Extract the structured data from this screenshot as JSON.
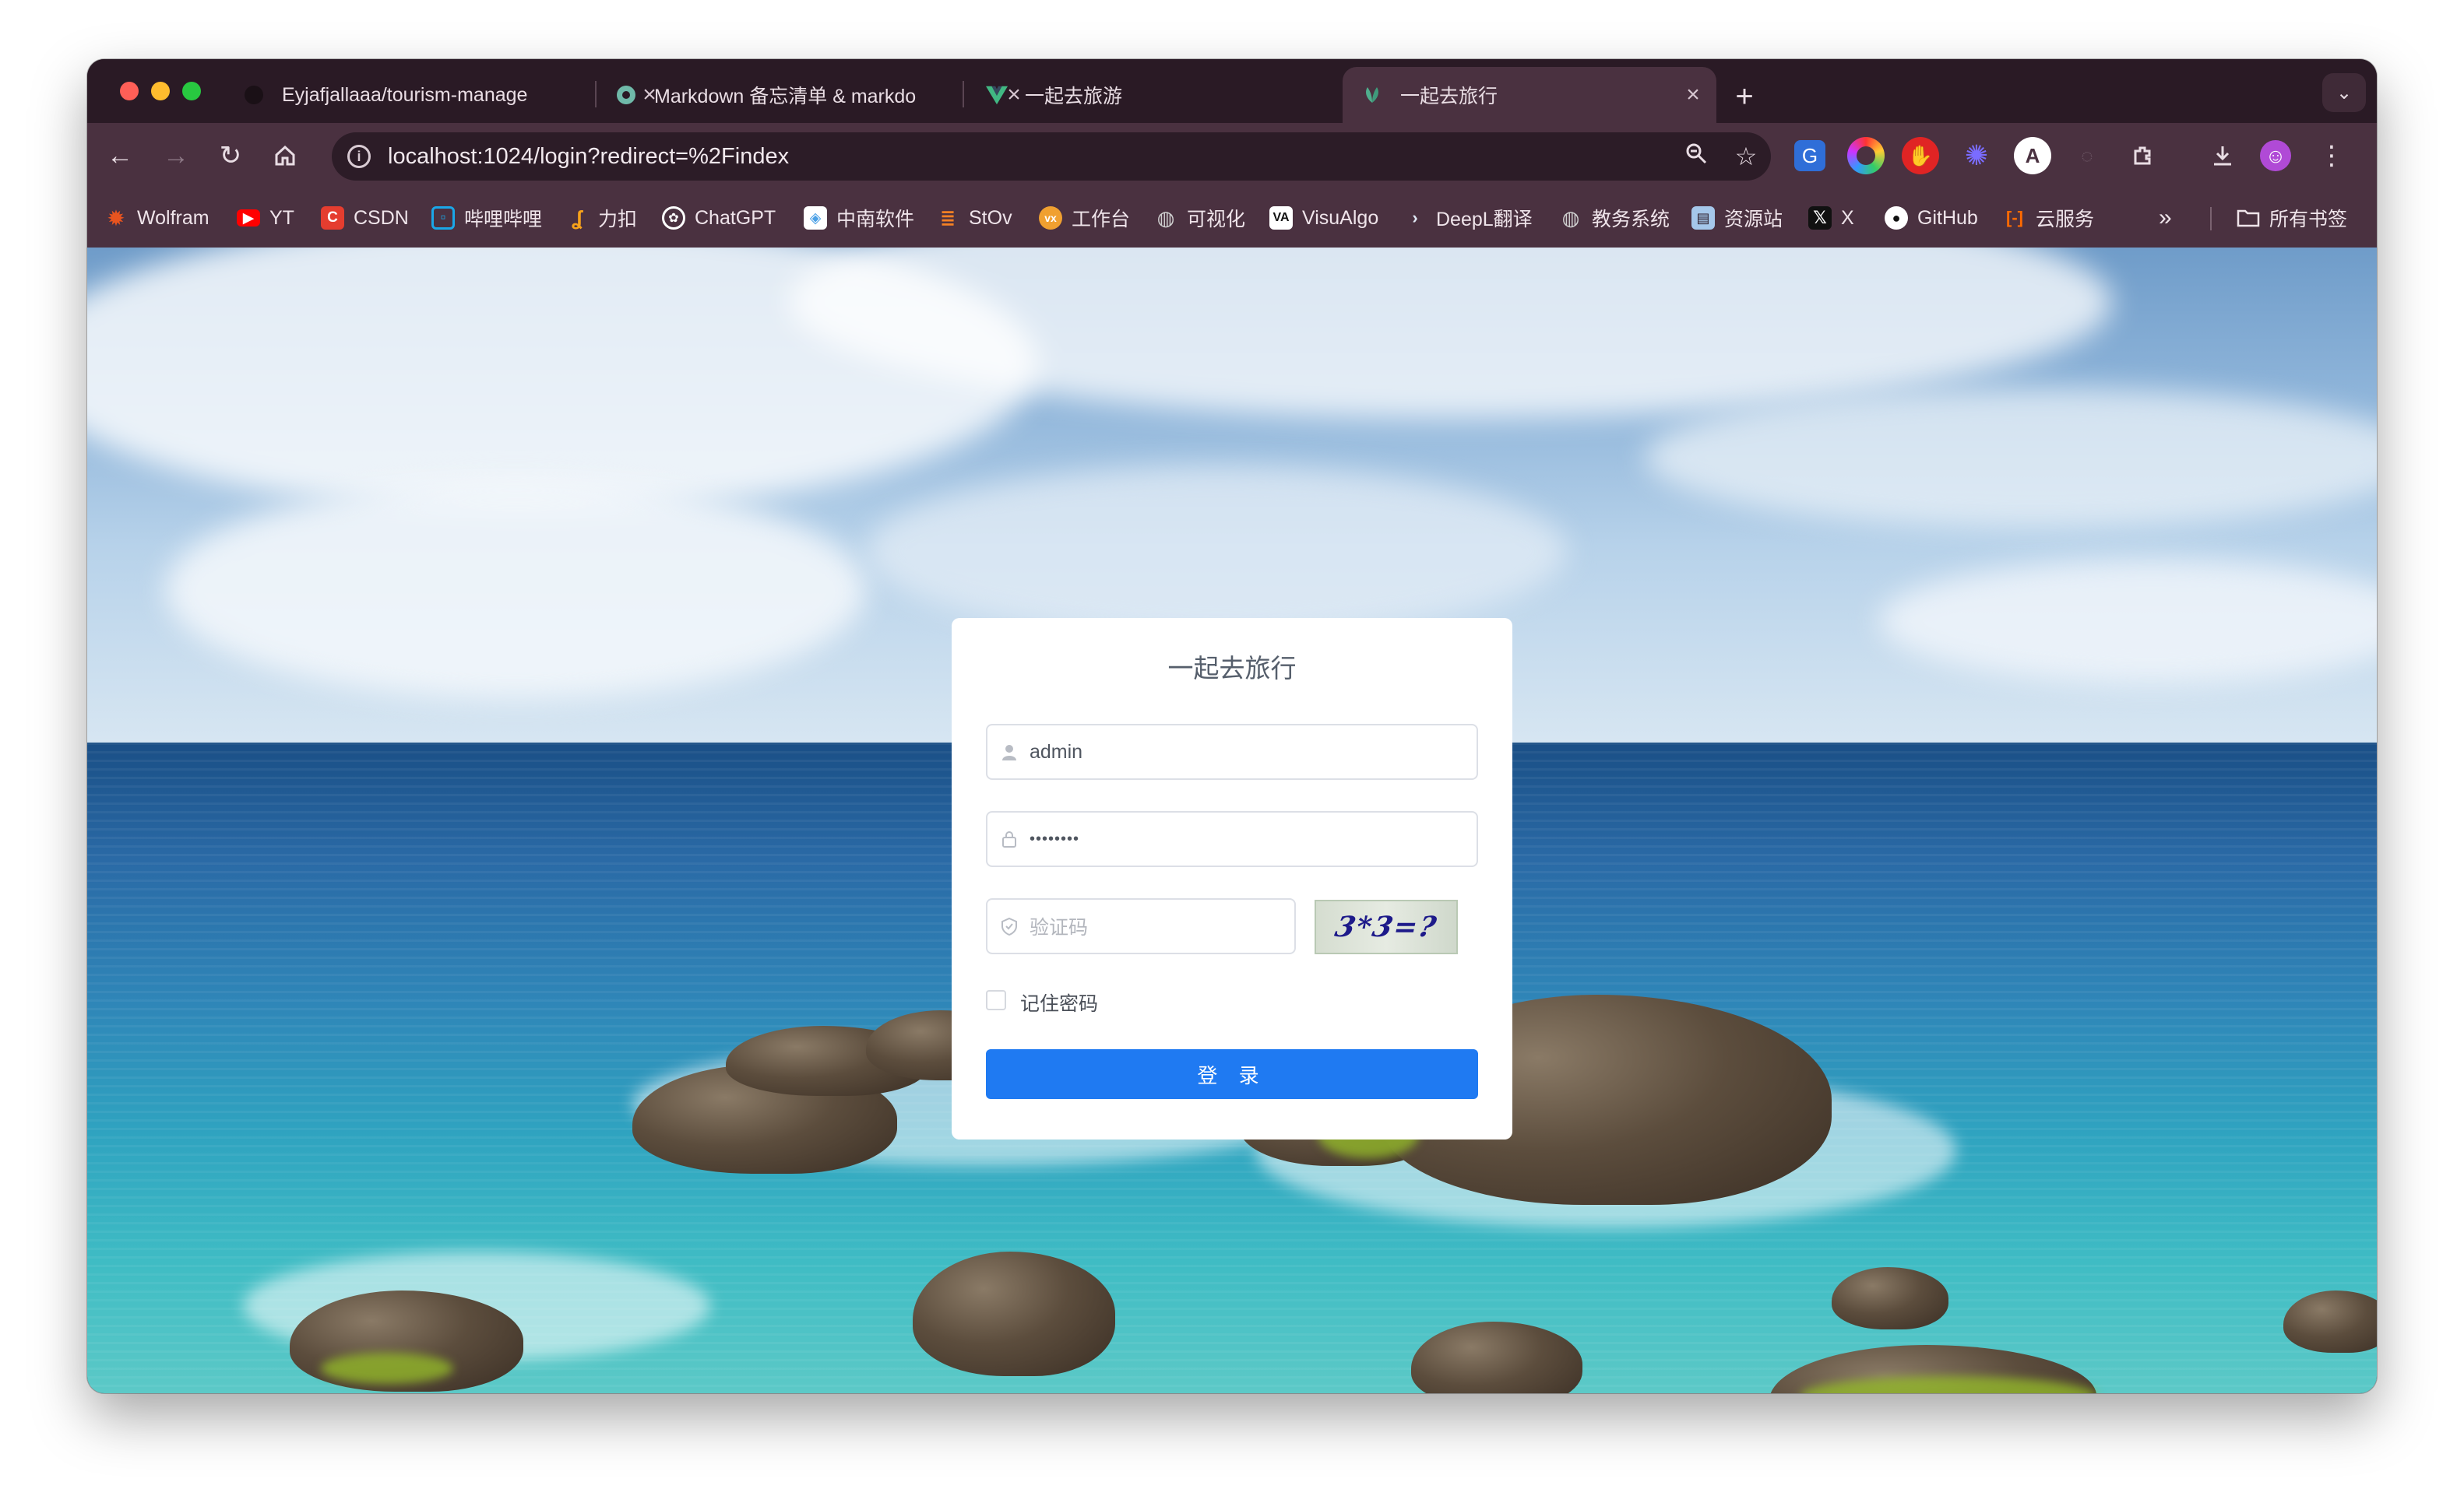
{
  "tabs": [
    {
      "title": "Eyjafjallaaa/tourism-manage",
      "icon": "github-icon"
    },
    {
      "title": "Markdown 备忘清单 & markdo",
      "icon": "quickref-icon"
    },
    {
      "title": "一起去旅游",
      "icon": "vue-icon"
    },
    {
      "title": "一起去旅行",
      "icon": "leaf-icon",
      "active": true
    }
  ],
  "address_bar": {
    "url": "localhost:1024/login?redirect=%2Findex"
  },
  "bookmarks": [
    {
      "label": "Wolfram",
      "color": "#e8541f"
    },
    {
      "label": "YT",
      "color": "#ff0000"
    },
    {
      "label": "CSDN",
      "color": "#e53d2f"
    },
    {
      "label": "哔哩哔哩",
      "color": "#1aa7e8"
    },
    {
      "label": "力扣",
      "color": "#f7a21b"
    },
    {
      "label": "ChatGPT",
      "color": "#ffffff"
    },
    {
      "label": "中南软件",
      "color": "#4aa0e6"
    },
    {
      "label": "StOv",
      "color": "#f48024"
    },
    {
      "label": "工作台",
      "color": "#f0a030"
    },
    {
      "label": "可视化",
      "color": "#cfcfcf"
    },
    {
      "label": "VisuAlgo",
      "color": "#111111"
    },
    {
      "label": "DeepL翻译",
      "color": "#0f2b46"
    },
    {
      "label": "教务系统",
      "color": "#cfcfcf"
    },
    {
      "label": "资源站",
      "color": "#a5c7ea"
    },
    {
      "label": "X",
      "color": "#111111"
    },
    {
      "label": "GitHub",
      "color": "#ffffff"
    },
    {
      "label": "云服务",
      "color": "#ff6a00"
    }
  ],
  "bookmarks_folder": "所有书签",
  "login": {
    "title": "一起去旅行",
    "username_value": "admin",
    "password_value": "••••••••",
    "captcha_placeholder": "验证码",
    "captcha_text": "3*3=?",
    "remember_label": "记住密码",
    "remember_checked": false,
    "submit_label": "登 录"
  },
  "colors": {
    "accent": "#1f7af2",
    "titlebar": "#2a1a25",
    "toolbar": "#4a3140"
  }
}
